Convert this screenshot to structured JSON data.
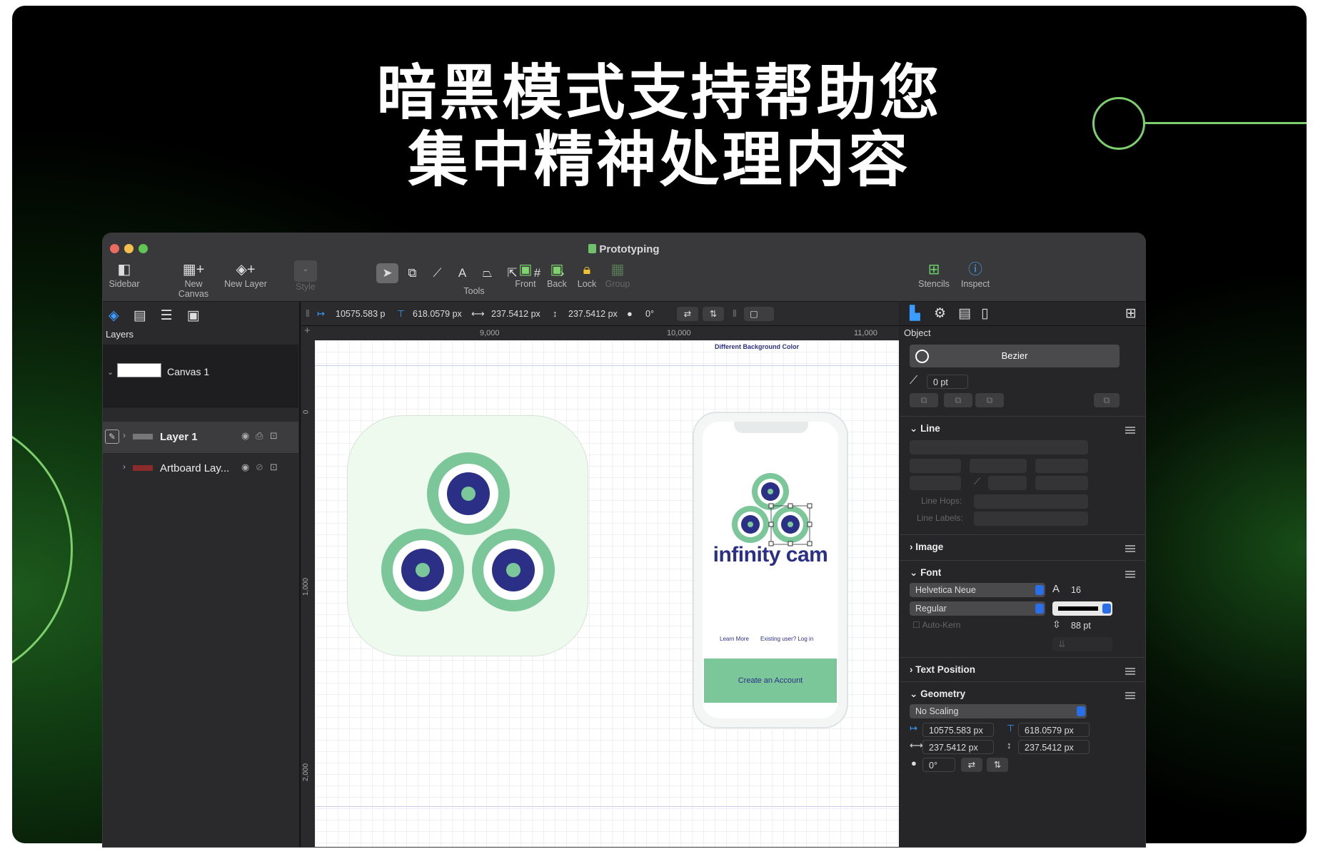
{
  "headline": {
    "line1": "暗黑模式支持帮助您",
    "line2": "集中精神处理内容"
  },
  "window": {
    "title": "Prototyping"
  },
  "toolbar": {
    "sidebar": "Sidebar",
    "new_canvas": "New Canvas",
    "new_layer": "New Layer",
    "style": "Style",
    "tools": "Tools",
    "front": "Front",
    "back": "Back",
    "lock": "Lock",
    "group": "Group",
    "stencils": "Stencils",
    "inspect": "Inspect"
  },
  "layers": {
    "header": "Layers",
    "canvas_name": "Canvas 1",
    "layer1": "Layer 1",
    "artboard": "Artboard Lay..."
  },
  "options": {
    "x": "10575.583 p",
    "y": "618.0579 px",
    "w": "237.5412 px",
    "h": "237.5412 px",
    "angle": "0°"
  },
  "ruler": {
    "t1": "9,000",
    "t2": "10,000",
    "t3": "11,000",
    "v1": "0",
    "v2": "1,000",
    "v3": "2,000"
  },
  "canvas": {
    "bg_label": "Different Background Color",
    "brand": "infinity cam",
    "learn_more": "Learn More",
    "existing": "Existing user? Log in",
    "create": "Create an Account"
  },
  "inspector": {
    "header": "Object",
    "shape": "Bezier",
    "corner": "0 pt",
    "line": "Line",
    "line_hops": "Line Hops:",
    "line_labels": "Line Labels:",
    "image": "Image",
    "font": "Font",
    "font_family": "Helvetica Neue",
    "font_size": "16",
    "font_style": "Regular",
    "auto_kern": "Auto-Kern",
    "line_height": "88 pt",
    "text_position": "Text Position",
    "geometry": "Geometry",
    "scaling": "No Scaling",
    "gx": "10575.583 px",
    "gy": "618.0579 px",
    "gw": "237.5412 px",
    "gh": "237.5412 px",
    "gangle": "0°"
  },
  "colors": {
    "accent": "#7ccf6c",
    "brand_navy": "#2b2f86",
    "brand_green": "#7bc79a"
  }
}
